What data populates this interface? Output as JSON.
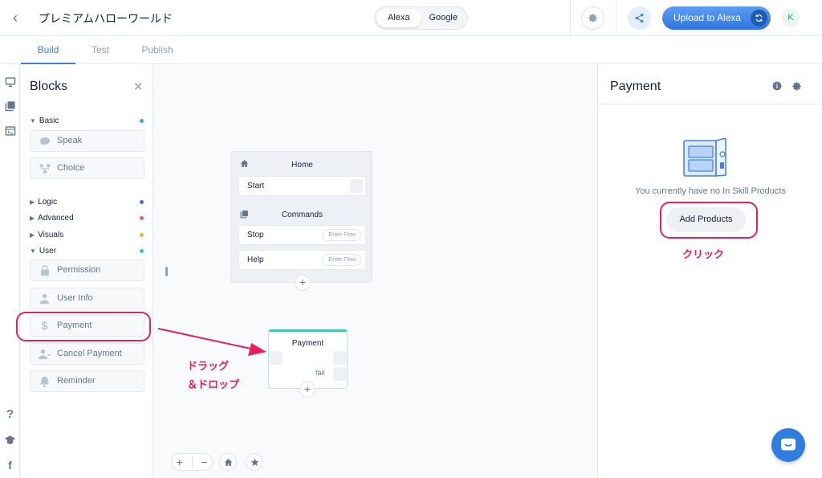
{
  "header": {
    "back_label": "‹",
    "title": "プレミアムハローワールド",
    "platforms": [
      "Alexa",
      "Google"
    ],
    "upload_label": "Upload to Alexa",
    "avatar_initial": "K"
  },
  "tabs": [
    "Build",
    "Test",
    "Publish"
  ],
  "blocks_panel": {
    "title": "Blocks",
    "close": "✕",
    "sections": {
      "basic": "Basic",
      "logic": "Logic",
      "advanced": "Advanced",
      "visuals": "Visuals",
      "user": "User"
    },
    "basic_items": [
      "Speak",
      "Choice"
    ],
    "user_items": [
      "Permission",
      "User Info",
      "Payment",
      "Cancel Payment",
      "Reminder"
    ],
    "dot_colors": {
      "basic": "#39a9e8",
      "logic": "#5a6be0",
      "advanced": "#e85a8c",
      "visuals": "#f0b63c",
      "user": "#38c9b0"
    }
  },
  "canvas": {
    "home_title": "Home",
    "start_label": "Start",
    "commands_title": "Commands",
    "commands": [
      {
        "label": "Stop",
        "action": "Enter Flow"
      },
      {
        "label": "Help",
        "action": "Enter Flow"
      }
    ],
    "payment_node": {
      "title": "Payment",
      "fail_label": "fail"
    },
    "drag_annotation_1": "ドラッグ",
    "drag_annotation_2": "＆ドロップ",
    "zoom_in": "+",
    "zoom_out": "−"
  },
  "right_panel": {
    "title": "Payment",
    "empty_text": "You currently have no In Skill Products",
    "add_button": "Add Products",
    "click_annotation": "クリック"
  },
  "accent_color": "#3d82e2",
  "annotation_color": "#e8205a"
}
